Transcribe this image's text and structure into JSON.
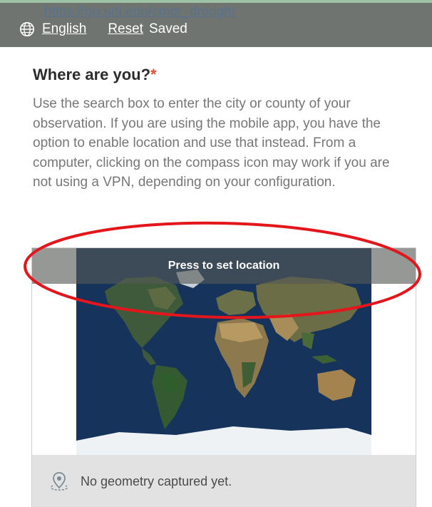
{
  "header": {
    "url_text": "https://go.unl.edu/cmor_drought",
    "language_label": "English",
    "reset_label": "Reset",
    "saved_label": "Saved"
  },
  "question": {
    "title": "Where are you?",
    "required_marker": "*",
    "description": "Use the search box to enter the city or county of your observation. If you are using the mobile app, you have the option to enable location and use that instead. From a computer, clicking on the compass icon may work if you are not using a VPN, depending on your configuration."
  },
  "map": {
    "banner_text": "Press to set location",
    "status_text": "No geometry captured yet."
  },
  "icons": {
    "language": "globe-icon",
    "status": "location-pin-icon"
  },
  "colors": {
    "header_bg": "#6f7470",
    "required_star": "#e0503a",
    "annotation_circle": "#e3161c",
    "ocean": "#16325a"
  }
}
